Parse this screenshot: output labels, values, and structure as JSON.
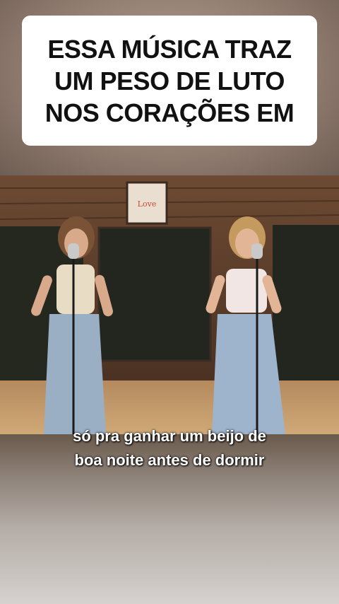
{
  "overlay_caption": {
    "text": "ESSA MÚSICA TRAZ\nUM PESO DE LUTO\nNOS CORAÇÕES EM"
  },
  "subtitles": {
    "line1": "só pra ganhar um beijo de",
    "line2": "boa noite antes de dormir"
  }
}
